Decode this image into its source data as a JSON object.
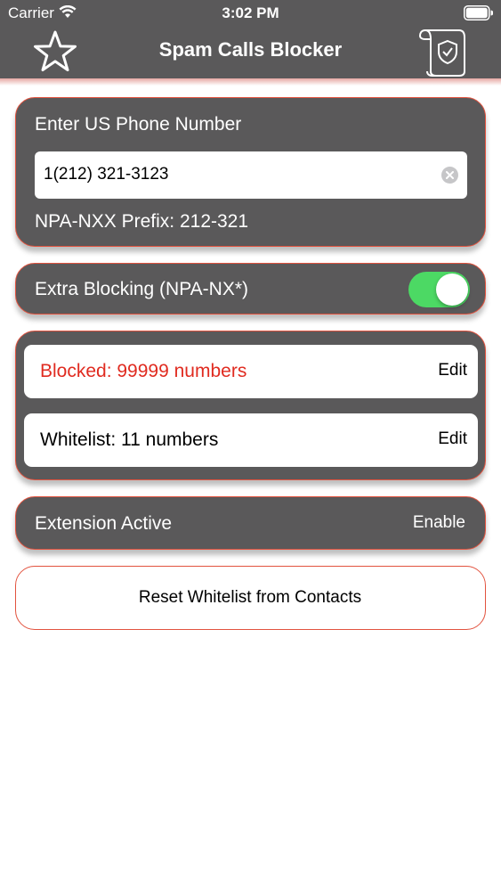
{
  "status_bar": {
    "carrier": "Carrier",
    "time": "3:02 PM",
    "icons": [
      "wifi-icon",
      "battery-icon"
    ]
  },
  "nav": {
    "title": "Spam Calls Blocker",
    "left_icon": "star-icon",
    "right_icon": "shield-scroll-icon"
  },
  "phone_section": {
    "label": "Enter US Phone Number",
    "input_value": "1(212) 321-3123",
    "prefix_text": "NPA-NXX Prefix: 212-321"
  },
  "extra_blocking": {
    "label": "Extra Blocking (NPA-NX*)",
    "enabled": true
  },
  "lists": {
    "blocked_label": "Blocked: 99999 numbers",
    "blocked_edit": "Edit",
    "whitelist_label": "Whitelist: 11 numbers",
    "whitelist_edit": "Edit"
  },
  "extension": {
    "label": "Extension Active",
    "action": "Enable"
  },
  "reset_button": {
    "label": "Reset Whitelist from Contacts"
  },
  "colors": {
    "bar_gray": "#5a595a",
    "accent_red": "#e2533f",
    "blocked_red": "#e02b20",
    "toggle_green": "#4cd964"
  }
}
